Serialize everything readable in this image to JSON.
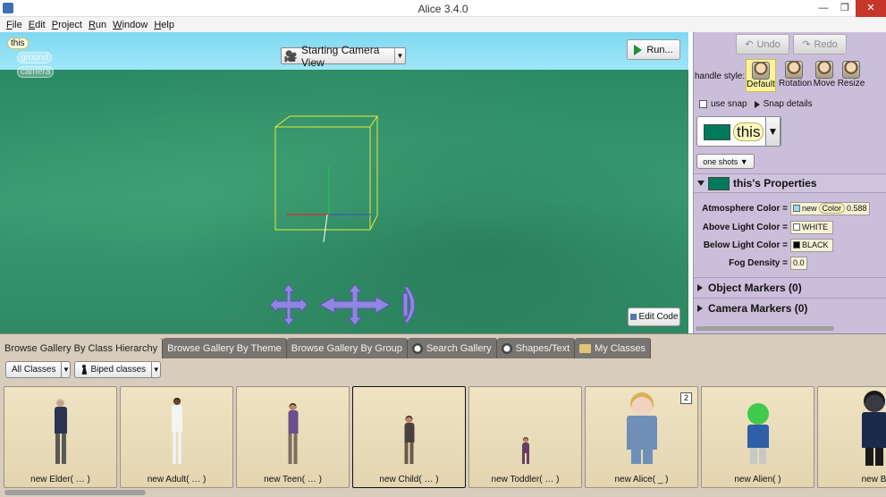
{
  "window": {
    "title": "Alice 3.4.0",
    "minimize": "—",
    "maximize": "❐",
    "close": "✕"
  },
  "menu": [
    "File",
    "Edit",
    "Project",
    "Run",
    "Window",
    "Help"
  ],
  "scene": {
    "tree": [
      "this",
      "ground",
      "camera"
    ],
    "camera_view": "Starting Camera View",
    "run_label": "Run...",
    "edit_code_label": "Edit Code",
    "sky_color": "#8fe0f4",
    "ground_color": "#2f8a64"
  },
  "right_panel": {
    "undo": "Undo",
    "redo": "Redo",
    "handle_style_label": "handle style:",
    "handle_styles": [
      "Default",
      "Rotation",
      "Move",
      "Resize"
    ],
    "selected_handle": "Default",
    "use_snap": "use snap",
    "snap_details": "Snap details",
    "selected_object": "this",
    "one_shots": "one shots",
    "properties_title": "this's Properties",
    "properties": [
      {
        "label": "Atmosphere Color =",
        "parts": [
          "new",
          "Color",
          "0.588"
        ],
        "swatch": "#8fe0f4"
      },
      {
        "label": "Above Light Color =",
        "parts": [
          "WHITE"
        ],
        "swatch": "#ffffff"
      },
      {
        "label": "Below Light Color =",
        "parts": [
          "BLACK"
        ],
        "swatch": "#000000"
      },
      {
        "label": "Fog Density =",
        "parts": [
          "0.0"
        ]
      }
    ],
    "sections": [
      "Object Markers (0)",
      "Camera Markers (0)"
    ]
  },
  "gallery": {
    "tabs": [
      "Browse Gallery By Class Hierarchy",
      "Browse Gallery By Theme",
      "Browse Gallery By Group",
      "Search Gallery",
      "Shapes/Text",
      "My Classes"
    ],
    "active_tab": 0,
    "filters": [
      "All Classes",
      "Biped classes"
    ],
    "items": [
      {
        "label": "new Elder( … )",
        "skin": "#c8a084",
        "shirt": "#2b3550",
        "pants": "#5a5a55",
        "hair": "#bfbfbf",
        "badge": ""
      },
      {
        "label": "new Adult( … )",
        "skin": "#6b4430",
        "shirt": "#f4f4f4",
        "pants": "#f0f0f0",
        "hair": "#2b1c12",
        "badge": ""
      },
      {
        "label": "new Teen( … )",
        "skin": "#b98767",
        "shirt": "#6b4e8e",
        "pants": "#7a6f60",
        "hair": "#3a2418",
        "badge": ""
      },
      {
        "label": "new Child( … )",
        "skin": "#b98767",
        "shirt": "#4a4040",
        "pants": "#6a5a4a",
        "hair": "#3a2418",
        "badge": ""
      },
      {
        "label": "new Toddler( … )",
        "skin": "#b98767",
        "shirt": "#6a3e60",
        "pants": "#6a3e60",
        "hair": "#3a2418",
        "badge": ""
      },
      {
        "label": "new Alice( _ )",
        "skin": "#f2d2c0",
        "shirt": "#6f8fb8",
        "pants": "#6f8fb8",
        "hair": "#d8b058",
        "badge": "2"
      },
      {
        "label": "new Alien( )",
        "skin": "#3ecb4a",
        "shirt": "#2f5fa8",
        "pants": "#c8c8c8",
        "hair": "#3ecb4a",
        "badge": ""
      },
      {
        "label": "new B",
        "skin": "#3a3a44",
        "shirt": "#1a2a4a",
        "pants": "#1a1a1a",
        "hair": "#1a1a1a",
        "badge": ""
      }
    ]
  },
  "colors": {
    "panel": "#cbbedb",
    "gallery": "#d8ccbd",
    "accent": "#007a5c"
  }
}
